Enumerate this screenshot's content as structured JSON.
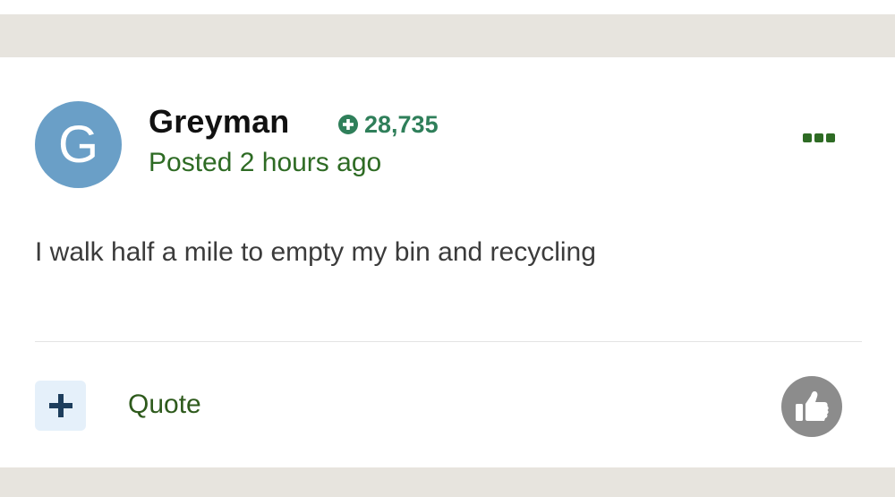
{
  "post": {
    "author": {
      "initial": "G",
      "name": "Greyman",
      "reputation": "28,735",
      "avatar_color": "#6a9fc7"
    },
    "posted_label": "Posted 2 hours ago",
    "body": "I walk half a mile to empty my bin and recycling",
    "actions": {
      "more_icon": "ellipsis-icon",
      "multiquote_icon": "plus-icon",
      "quote_label": "Quote",
      "like_icon": "thumbs-up-icon"
    }
  },
  "colors": {
    "accent_green": "#2e6b24",
    "reputation_green": "#2f7f5a",
    "page_background": "#e7e4de",
    "like_gray": "#8c8c8c"
  }
}
